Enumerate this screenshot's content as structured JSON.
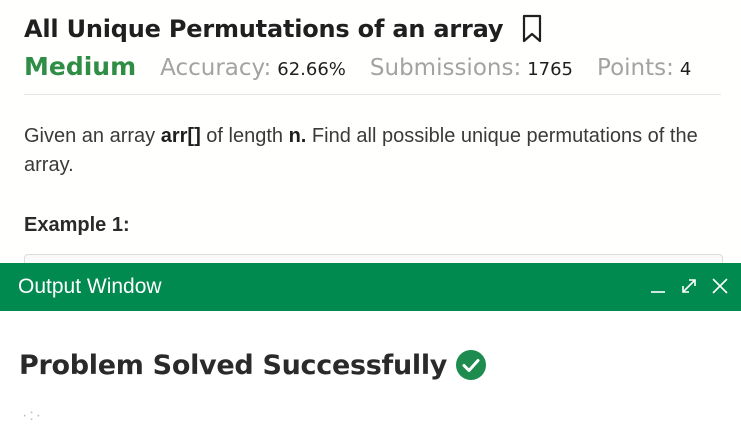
{
  "problem": {
    "title": "All Unique Permutations of an array",
    "difficulty": "Medium",
    "accuracy_label": "Accuracy:",
    "accuracy_value": "62.66%",
    "submissions_label": "Submissions:",
    "submissions_value": "1765",
    "points_label": "Points:",
    "points_value": "4",
    "description_parts": {
      "p1": "Given an array ",
      "b1": "arr[]",
      "p2": " of length ",
      "b2": "n.",
      "p3": " Find all possible unique permutations of the array."
    },
    "example_heading": "Example 1:"
  },
  "output_window": {
    "title": "Output Window",
    "result_text": "Problem Solved Successfully",
    "faint_text": "·:·"
  },
  "colors": {
    "accent_green": "#2f8d46",
    "output_bar": "#018a4f",
    "check_green": "#1e8c4e"
  },
  "icons": {
    "bookmark": "bookmark-icon",
    "minimize": "minimize-icon",
    "expand": "expand-icon",
    "close": "close-icon",
    "check": "check-circle-icon"
  }
}
